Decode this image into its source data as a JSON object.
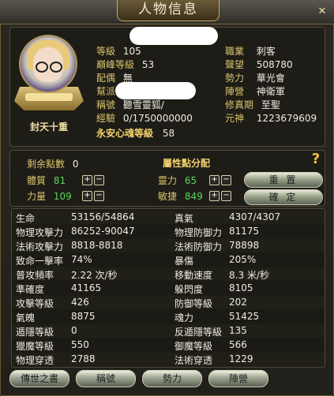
{
  "window": {
    "title": "人物信息",
    "close_glyph": "✕"
  },
  "profile": {
    "rank_name": "封天十重",
    "left": [
      {
        "label": "等級",
        "value": "105"
      },
      {
        "label": "巔峰等級",
        "value": "53"
      },
      {
        "label": "配偶",
        "value": "無"
      },
      {
        "label": "幫派",
        "value": ""
      },
      {
        "label": "稱號",
        "value": "聽雪靈狐/"
      },
      {
        "label": "經驗",
        "value": "0/1750000000"
      }
    ],
    "soul_label": "永安心魂等級",
    "soul_value": "58",
    "right": [
      {
        "label": "職業",
        "value": "刺客"
      },
      {
        "label": "聲望",
        "value": "508780"
      },
      {
        "label": "勢力",
        "value": "華光會"
      },
      {
        "label": "陣營",
        "value": "神衛軍"
      },
      {
        "label": "修真期",
        "value": "至聖"
      },
      {
        "label": "元神",
        "value": "1223679609"
      }
    ]
  },
  "attributes": {
    "remaining_label": "剩余點數",
    "remaining_value": "0",
    "section_title": "屬性點分配",
    "items": [
      {
        "label": "體質",
        "value": "81"
      },
      {
        "label": "力量",
        "value": "109"
      },
      {
        "label": "靈力",
        "value": "65"
      },
      {
        "label": "敏捷",
        "value": "849"
      }
    ],
    "plus": "+",
    "minus": "−",
    "reset_label": "重 置",
    "confirm_label": "確 定",
    "help": "?"
  },
  "stats": [
    {
      "l_label": "生命",
      "l_value": "53156/54864",
      "r_label": "真氣",
      "r_value": "4307/4307"
    },
    {
      "l_label": "物理攻擊力",
      "l_value": "86252-90047",
      "r_label": "物理防御力",
      "r_value": "81175"
    },
    {
      "l_label": "法術攻擊力",
      "l_value": "8818-8818",
      "r_label": "法術防御力",
      "r_value": "78898"
    },
    {
      "l_label": "致命一擊率",
      "l_value": "74%",
      "r_label": "暴傷",
      "r_value": "205%"
    },
    {
      "l_label": "普攻頻率",
      "l_value": "2.22 次/秒",
      "r_label": "移動速度",
      "r_value": "8.3 米/秒"
    },
    {
      "l_label": "準確度",
      "l_value": "41165",
      "r_label": "躲閃度",
      "r_value": "8105"
    },
    {
      "l_label": "攻擊等級",
      "l_value": "426",
      "r_label": "防御等級",
      "r_value": "202"
    },
    {
      "l_label": "氣魄",
      "l_value": "8875",
      "r_label": "魂力",
      "r_value": "51425"
    },
    {
      "l_label": "遁隱等級",
      "l_value": "0",
      "r_label": "反遁隱等級",
      "r_value": "135"
    },
    {
      "l_label": "獵魔等級",
      "l_value": "550",
      "r_label": "御魔等級",
      "r_value": "566"
    },
    {
      "l_label": "物理穿透",
      "l_value": "2788",
      "r_label": "法術穿透",
      "r_value": "1229"
    }
  ],
  "bottom_buttons": [
    {
      "label": "傳世之書"
    },
    {
      "label": "稱號"
    },
    {
      "label": "勢力"
    },
    {
      "label": "陣營"
    }
  ]
}
